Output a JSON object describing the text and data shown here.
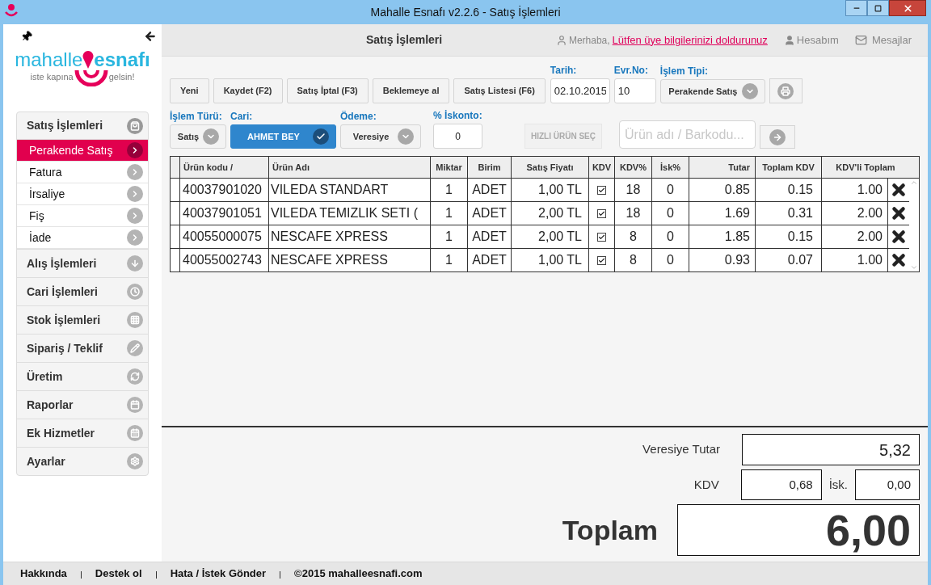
{
  "window": {
    "title": "Mahalle Esnafı v2.2.6 - Satış İşlemleri"
  },
  "sidebar": {
    "logo": {
      "word_1": "mahalle",
      "word_2": "esnafı",
      "tagline_1": "iste kapına",
      "tagline_2": "gelsin!"
    },
    "sections": [
      {
        "label": "Satış İşlemleri",
        "expanded": true,
        "items": [
          {
            "label": "Perakende Satış",
            "selected": true
          },
          {
            "label": "Fatura",
            "selected": false
          },
          {
            "label": "İrsaliye",
            "selected": false
          },
          {
            "label": "Fiş",
            "selected": false
          },
          {
            "label": "İade",
            "selected": false
          }
        ]
      },
      {
        "label": "Alış İşlemleri",
        "expanded": false
      },
      {
        "label": "Cari İşlemleri",
        "expanded": false
      },
      {
        "label": "Stok İşlemleri",
        "expanded": false
      },
      {
        "label": "Sipariş / Teklif",
        "expanded": false
      },
      {
        "label": "Üretim",
        "expanded": false
      },
      {
        "label": "Raporlar",
        "expanded": false
      },
      {
        "label": "Ek Hizmetler",
        "expanded": false
      },
      {
        "label": "Ayarlar",
        "expanded": false
      }
    ]
  },
  "header": {
    "title": "Satış İşlemleri",
    "greeting": "Merhaba,",
    "profile_link": "Lütfen üye bilgilerinizi doldurunuz",
    "account": "Hesabım",
    "messages": "Mesajlar"
  },
  "toolbar": {
    "buttons": [
      "Yeni",
      "Kaydet (F2)",
      "Satış İptal (F3)",
      "Beklemeye al",
      "Satış Listesi (F6)"
    ],
    "date": {
      "label": "Tarih:",
      "value": "02.10.2015"
    },
    "doc_no": {
      "label": "Evr.No:",
      "value": "10"
    },
    "type": {
      "label": "İşlem Tipi:",
      "value": "Perakende Satış"
    }
  },
  "filters": {
    "kind": {
      "label": "İşlem Türü:",
      "value": "Satış"
    },
    "account": {
      "label": "Cari:",
      "value": "AHMET BEY"
    },
    "payment": {
      "label": "Ödeme:",
      "value": "Veresiye"
    },
    "discount": {
      "label": "% İskonto:",
      "value": "0"
    },
    "quick_button": {
      "label": "HIZLI ÜRÜN SEÇ",
      "disabled": true
    },
    "search": {
      "placeholder": "Ürün adı / Barkodu..."
    }
  },
  "table": {
    "columns": [
      "Ürün kodu /",
      "Ürün Adı",
      "Miktar",
      "Birim",
      "Satış Fiyatı",
      "KDV",
      "KDV%",
      "İsk%",
      "Tutar",
      "Toplam KDV",
      "KDV'li Toplam"
    ],
    "rows": [
      {
        "code": "40037901020",
        "name": "VILEDA STANDART",
        "qty": "1",
        "unit": "ADET",
        "price": "1,00 TL",
        "vat": true,
        "vat_rate": "18",
        "discount": "0",
        "amount": "0.85",
        "vat_total": "0.15",
        "total": "1.00"
      },
      {
        "code": "40037901051",
        "name": "VILEDA TEMIZLIK SETI (",
        "qty": "1",
        "unit": "ADET",
        "price": "2,00 TL",
        "vat": true,
        "vat_rate": "18",
        "discount": "0",
        "amount": "1.69",
        "vat_total": "0.31",
        "total": "2.00"
      },
      {
        "code": "40055000075",
        "name": "NESCAFE XPRESS",
        "qty": "1",
        "unit": "ADET",
        "price": "2,00 TL",
        "vat": true,
        "vat_rate": "8",
        "discount": "0",
        "amount": "1.85",
        "vat_total": "0.15",
        "total": "2.00"
      },
      {
        "code": "40055002743",
        "name": "NESCAFE XPRESS",
        "qty": "1",
        "unit": "ADET",
        "price": "1,00 TL",
        "vat": true,
        "vat_rate": "8",
        "discount": "0",
        "amount": "0.93",
        "vat_total": "0.07",
        "total": "1.00"
      }
    ]
  },
  "summary": {
    "credit_label": "Veresiye Tutar",
    "credit_value": "5,32",
    "vat_label": "KDV",
    "vat_value": "0,68",
    "discount_label": "İsk.",
    "discount_value": "0,00",
    "total_label": "Toplam",
    "total_value": "6,00"
  },
  "footer": {
    "links": [
      "Hakkında",
      "Destek ol",
      "Hata / İstek Gönder"
    ],
    "copyright": "©2015 mahalleesnafi.com"
  }
}
